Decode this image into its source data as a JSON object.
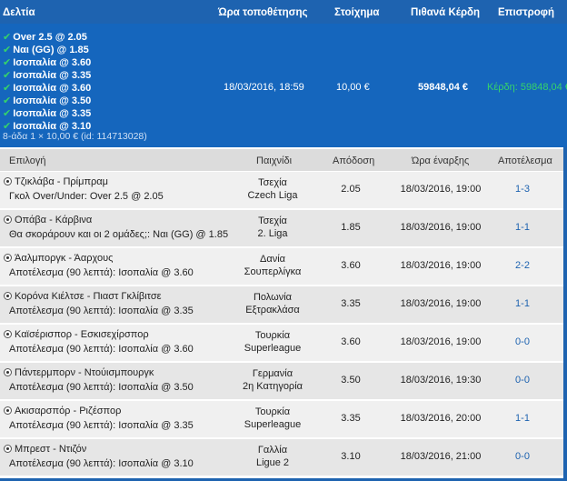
{
  "header": {
    "col_slip": "Δελτία",
    "col_time": "Ώρα τοποθέτησης",
    "col_stake": "Στοίχημα",
    "col_win": "Πιθανά Κέρδη",
    "col_return": "Επιστροφή"
  },
  "bet": {
    "selections": [
      "Over 2.5 @ 2.05",
      "Ναι (GG) @ 1.85",
      "Ισοπαλία @ 3.60",
      "Ισοπαλία @ 3.35",
      "Ισοπαλία @ 3.60",
      "Ισοπαλία @ 3.50",
      "Ισοπαλία @ 3.35",
      "Ισοπαλία @ 3.10"
    ],
    "meta": "8-άδα   1 × 10,00 € (id: 114713028)",
    "placed_time": "18/03/2016, 18:59",
    "stake": "10,00 €",
    "potential": "59848,04 €",
    "return": "Κέρδη: 59848,04 €"
  },
  "table": {
    "h_selection": "Επιλογή",
    "h_game": "Παιχνίδι",
    "h_odds": "Απόδοση",
    "h_start": "Ώρα έναρξης",
    "h_result": "Αποτέλεσμα",
    "rows": [
      {
        "match": "Τζικλάβα - Πρίμπραμ",
        "market": "Γκολ Over/Under: Over 2.5 @ 2.05",
        "country": "Τσεχία",
        "league": "Czech Liga",
        "odds": "2.05",
        "start": "18/03/2016, 19:00",
        "result": "1-3"
      },
      {
        "match": "Οπάβα - Κάρβινα",
        "market": "Θα σκοράρουν και οι 2 ομάδες;: Ναι (GG) @ 1.85",
        "country": "Τσεχία",
        "league": "2. Liga",
        "odds": "1.85",
        "start": "18/03/2016, 19:00",
        "result": "1-1"
      },
      {
        "match": "Άαλμποργκ - Άαρχους",
        "market": "Αποτέλεσμα (90 λεπτά): Ισοπαλία @ 3.60",
        "country": "Δανία",
        "league": "Σουπερλίγκα",
        "odds": "3.60",
        "start": "18/03/2016, 19:00",
        "result": "2-2"
      },
      {
        "match": "Κορόνα Κιέλτσε - Πιαστ Γκλίβιτσε",
        "market": "Αποτέλεσμα (90 λεπτά): Ισοπαλία @ 3.35",
        "country": "Πολωνία",
        "league": "Εξτρακλάσα",
        "odds": "3.35",
        "start": "18/03/2016, 19:00",
        "result": "1-1"
      },
      {
        "match": "Καϊσέρισπορ - Εσκισεχίρσπορ",
        "market": "Αποτέλεσμα (90 λεπτά): Ισοπαλία @ 3.60",
        "country": "Τουρκία",
        "league": "Superleague",
        "odds": "3.60",
        "start": "18/03/2016, 19:00",
        "result": "0-0"
      },
      {
        "match": "Πάντερμπορν - Ντούισμπουργκ",
        "market": "Αποτέλεσμα (90 λεπτά): Ισοπαλία @ 3.50",
        "country": "Γερμανία",
        "league": "2η Κατηγορία",
        "odds": "3.50",
        "start": "18/03/2016, 19:30",
        "result": "0-0"
      },
      {
        "match": "Ακισαρσπόρ - Ριζέσπορ",
        "market": "Αποτέλεσμα (90 λεπτά): Ισοπαλία @ 3.35",
        "country": "Τουρκία",
        "league": "Superleague",
        "odds": "3.35",
        "start": "18/03/2016, 20:00",
        "result": "1-1"
      },
      {
        "match": "Μπρεστ - Ντιζόν",
        "market": "Αποτέλεσμα (90 λεπτά): Ισοπαλία @ 3.10",
        "country": "Γαλλία",
        "league": "Ligue 2",
        "odds": "3.10",
        "start": "18/03/2016, 21:00",
        "result": "0-0"
      }
    ]
  },
  "colors": {
    "header_bg": "#1e63b0",
    "panel_bg": "#1566bd",
    "check": "#36d36a",
    "result_link": "#1e63b0"
  }
}
